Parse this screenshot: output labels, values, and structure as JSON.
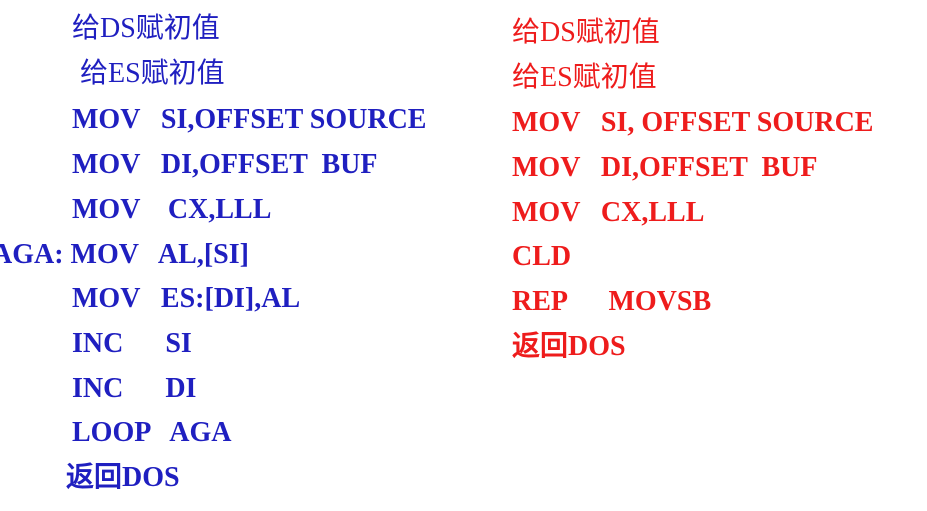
{
  "left_column": {
    "color": "#1f1fc0",
    "lines": [
      "给DS赋初值",
      "给ES赋初值",
      "MOV   SI,OFFSET SOURCE",
      "MOV   DI,OFFSET  BUF",
      "MOV    CX,LLL",
      "AGA: MOV   AL,[SI]",
      "MOV   ES:[DI],AL",
      "INC      SI",
      "INC      DI",
      "LOOP   AGA",
      "返回DOS"
    ]
  },
  "right_column": {
    "color": "#ee1c1c",
    "lines": [
      "给DS赋初值",
      "给ES赋初值",
      "MOV   SI, OFFSET SOURCE",
      "MOV   DI,OFFSET  BUF",
      "MOV   CX,LLL",
      "CLD",
      "REP      MOVSB",
      "返回DOS"
    ]
  }
}
